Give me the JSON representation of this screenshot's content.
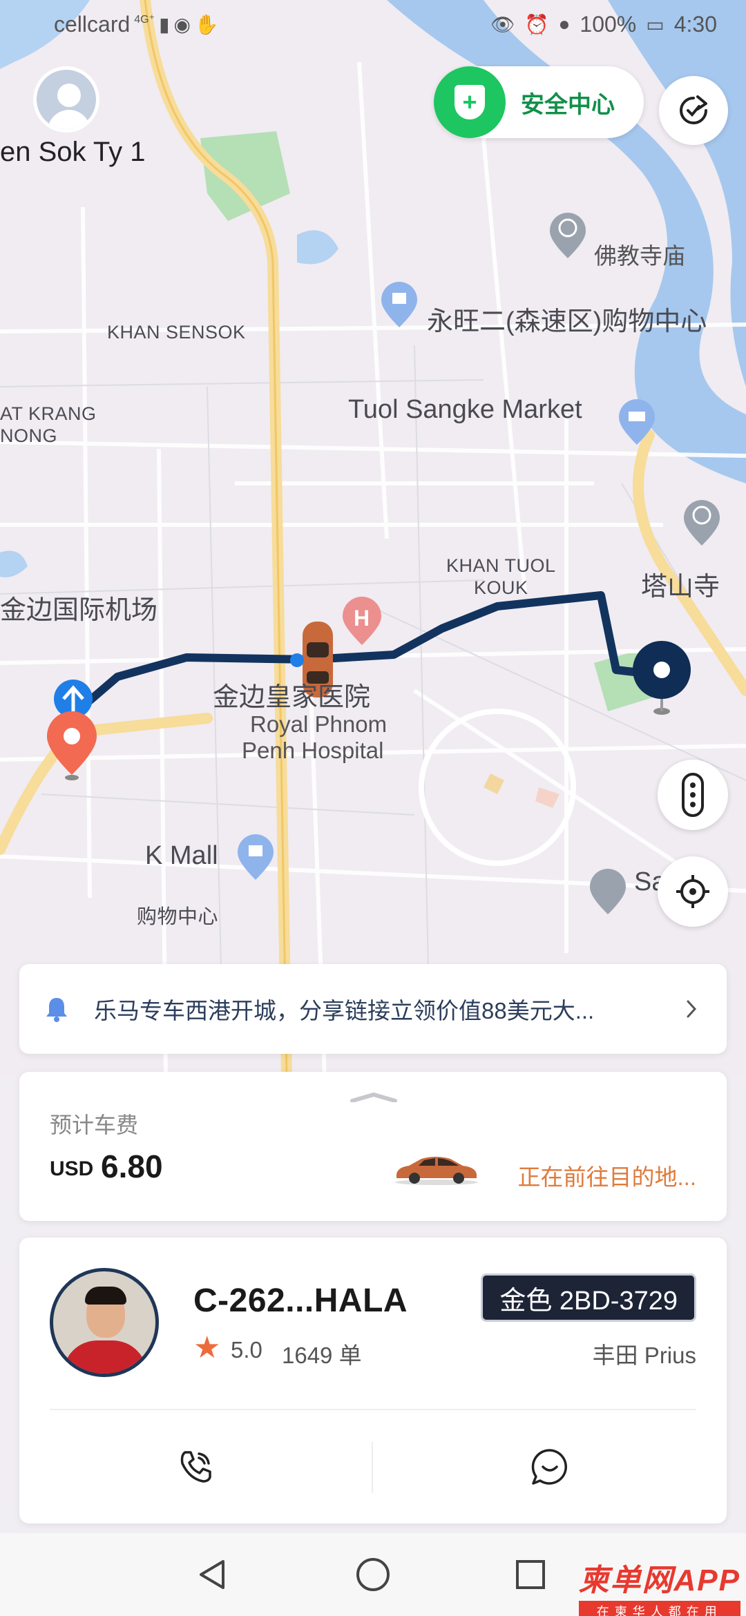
{
  "status_bar": {
    "carrier": "cellcard",
    "network": "4G⁺",
    "battery": "100%",
    "time": "4:30"
  },
  "user": {
    "name": "en Sok Ty 1"
  },
  "safety": {
    "label": "安全中心"
  },
  "map_labels": {
    "khan_sensok": "KHAN SENSOK",
    "at_krang": "AT KRANG",
    "nong": "NONG",
    "buddhist_temple": "佛教寺庙",
    "aeon_mall": "永旺二(森速区)购物中心",
    "tuol_sangke": "Tuol Sangke Market",
    "khan_tuol_kouk_1": "KHAN TUOL",
    "khan_tuol_kouk_2": "KOUK",
    "wat_phnom": "塔山寺",
    "airport": "金边国际机场",
    "hospital_cn": "金边皇家医院",
    "hospital_en_1": "Royal Phnom",
    "hospital_en_2": "Penh Hospital",
    "kmall": "K Mall",
    "kmall_cn": "购物中心",
    "sa_partial": "Sa"
  },
  "notice": {
    "text": "乐马专车西港开城，分享链接立领价值88美元大..."
  },
  "fare": {
    "label": "预计车费",
    "currency": "USD",
    "amount": "6.80",
    "status": "正在前往目的地..."
  },
  "driver": {
    "name": "C-262...HALA",
    "rating": "5.0",
    "orders": "1649 单",
    "plate": "金色 2BD-3729",
    "car_model": "丰田 Prius"
  },
  "watermark": {
    "main": "柬单网APP",
    "sub": "在柬华人都在用"
  },
  "colors": {
    "route": "#13335f",
    "safety_green": "#1dc660",
    "status_orange": "#e07a3a",
    "origin_pin": "#f26a52",
    "dest_pin": "#0f2d55"
  }
}
